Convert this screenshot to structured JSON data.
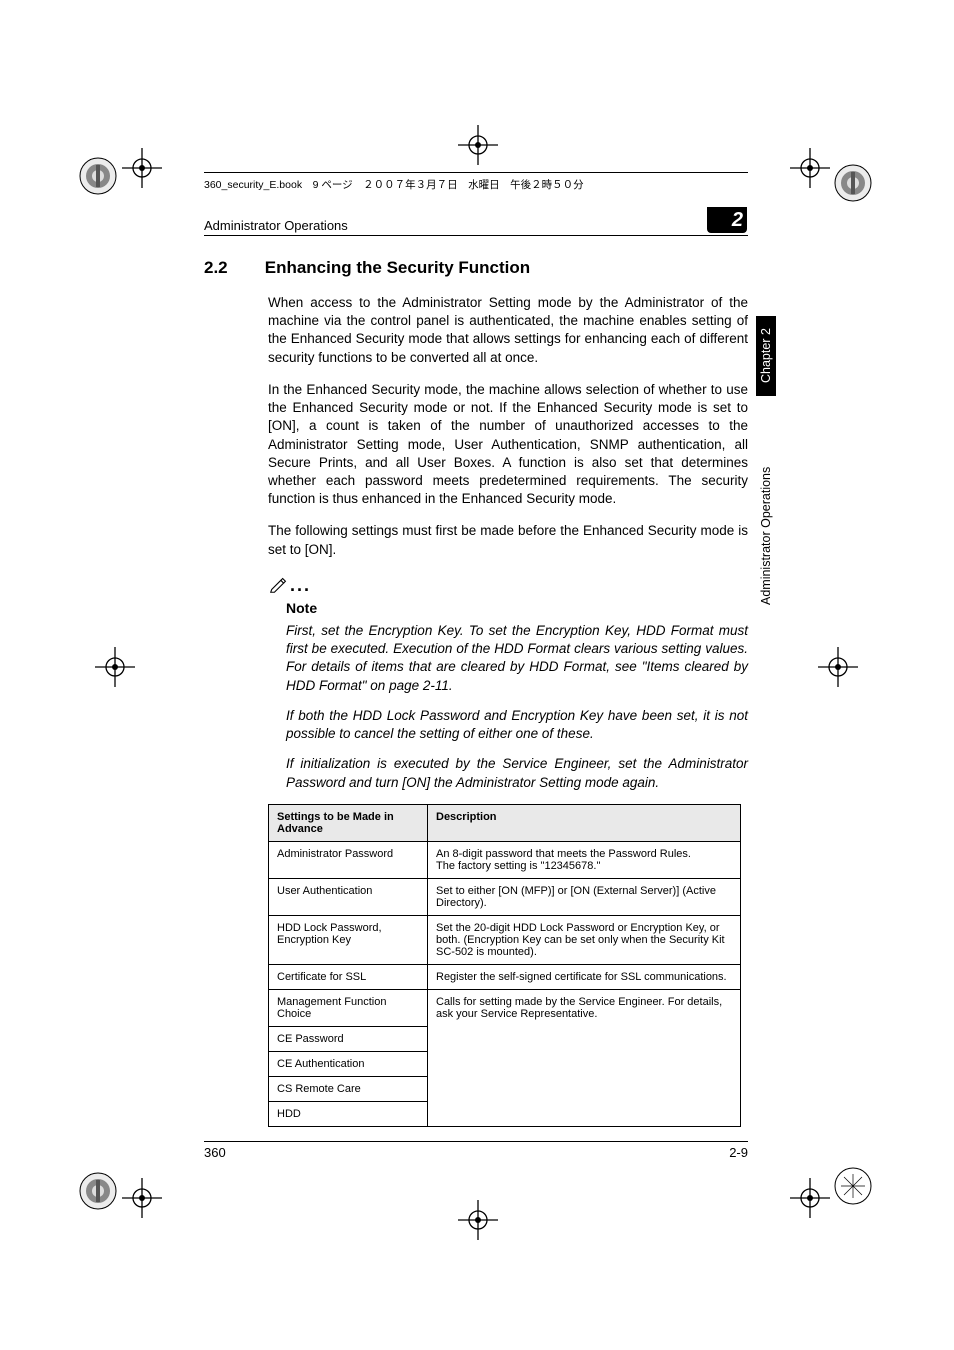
{
  "header_filename": "360_security_E.book　9 ページ　２００７年３月７日　水曜日　午後２時５０分",
  "running_head": "Administrator Operations",
  "chapter_badge": "2",
  "side_chapter": "Chapter 2",
  "side_ops": "Administrator Operations",
  "section_number": "2.2",
  "section_title": "Enhancing the Security Function",
  "para1": "When access to the Administrator Setting mode by the Administrator of the machine via the control panel is authenticated, the machine enables setting of the Enhanced Security mode that allows settings for enhancing each of different security functions to be converted all at once.",
  "para2": "In the Enhanced Security mode, the machine allows selection of whether to use the Enhanced Security mode or not. If the Enhanced Security mode is set to [ON], a count is taken of the number of unauthorized accesses to the Administrator Setting mode, User Authentication, SNMP authentication, all Secure Prints, and all User Boxes. A function is also set that determines whether each password meets predetermined requirements. The security function is thus enhanced in the Enhanced Security mode.",
  "para3": "The following settings must first be made before the Enhanced Security mode is set to [ON].",
  "note_label": "Note",
  "note1": "First, set the Encryption Key. To set the Encryption Key, HDD Format must first be executed. Execution of the HDD Format clears various setting values. For details of items that are cleared by HDD Format, see \"Items cleared by HDD Format\" on page 2-11.",
  "note2": "If both the HDD Lock Password and Encryption Key have been set, it is not possible to cancel the setting of either one of these.",
  "note3": "If initialization is executed by the Service Engineer, set the Administrator Password and turn [ON] the Administrator Setting mode again.",
  "table": {
    "head_col1": "Settings to be Made in Advance",
    "head_col2": "Description",
    "r1c1": "Administrator Password",
    "r1c2": "An 8-digit password that meets the Password Rules.\nThe factory setting is \"12345678.\"",
    "r2c1": "User Authentication",
    "r2c2": "Set to either [ON (MFP)] or [ON (External Server)] (Active Directory).",
    "r3c1": "HDD Lock Password, Encryption Key",
    "r3c2": "Set the 20-digit HDD Lock Password or Encryption Key, or both. (Encryption Key can be set only when the Security Kit SC-502 is mounted).",
    "r4c1": "Certificate for SSL",
    "r4c2": "Register the self-signed certificate for SSL communications.",
    "r5c1": "Management Function Choice",
    "r5c2": "Calls for setting made by the Service Engineer. For details, ask your Service Representative.",
    "r6c1": "CE Password",
    "r7c1": "CE Authentication",
    "r8c1": "CS Remote Care",
    "r9c1": "HDD"
  },
  "footer_left": "360",
  "footer_right": "2-9"
}
